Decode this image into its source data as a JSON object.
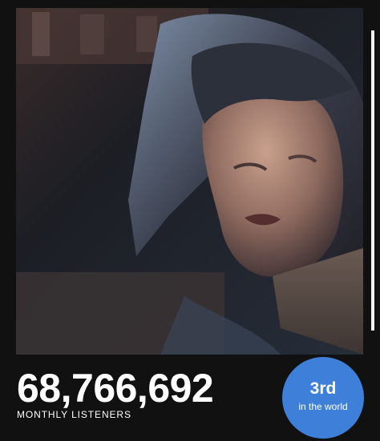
{
  "artist": {
    "monthly_listeners": "68,766,692",
    "monthly_listeners_label": "MONTHLY LISTENERS"
  },
  "rank": {
    "value": "3rd",
    "label": "in the world"
  },
  "colors": {
    "background": "#111111",
    "badge": "#3d7fd9",
    "text": "#ffffff"
  }
}
